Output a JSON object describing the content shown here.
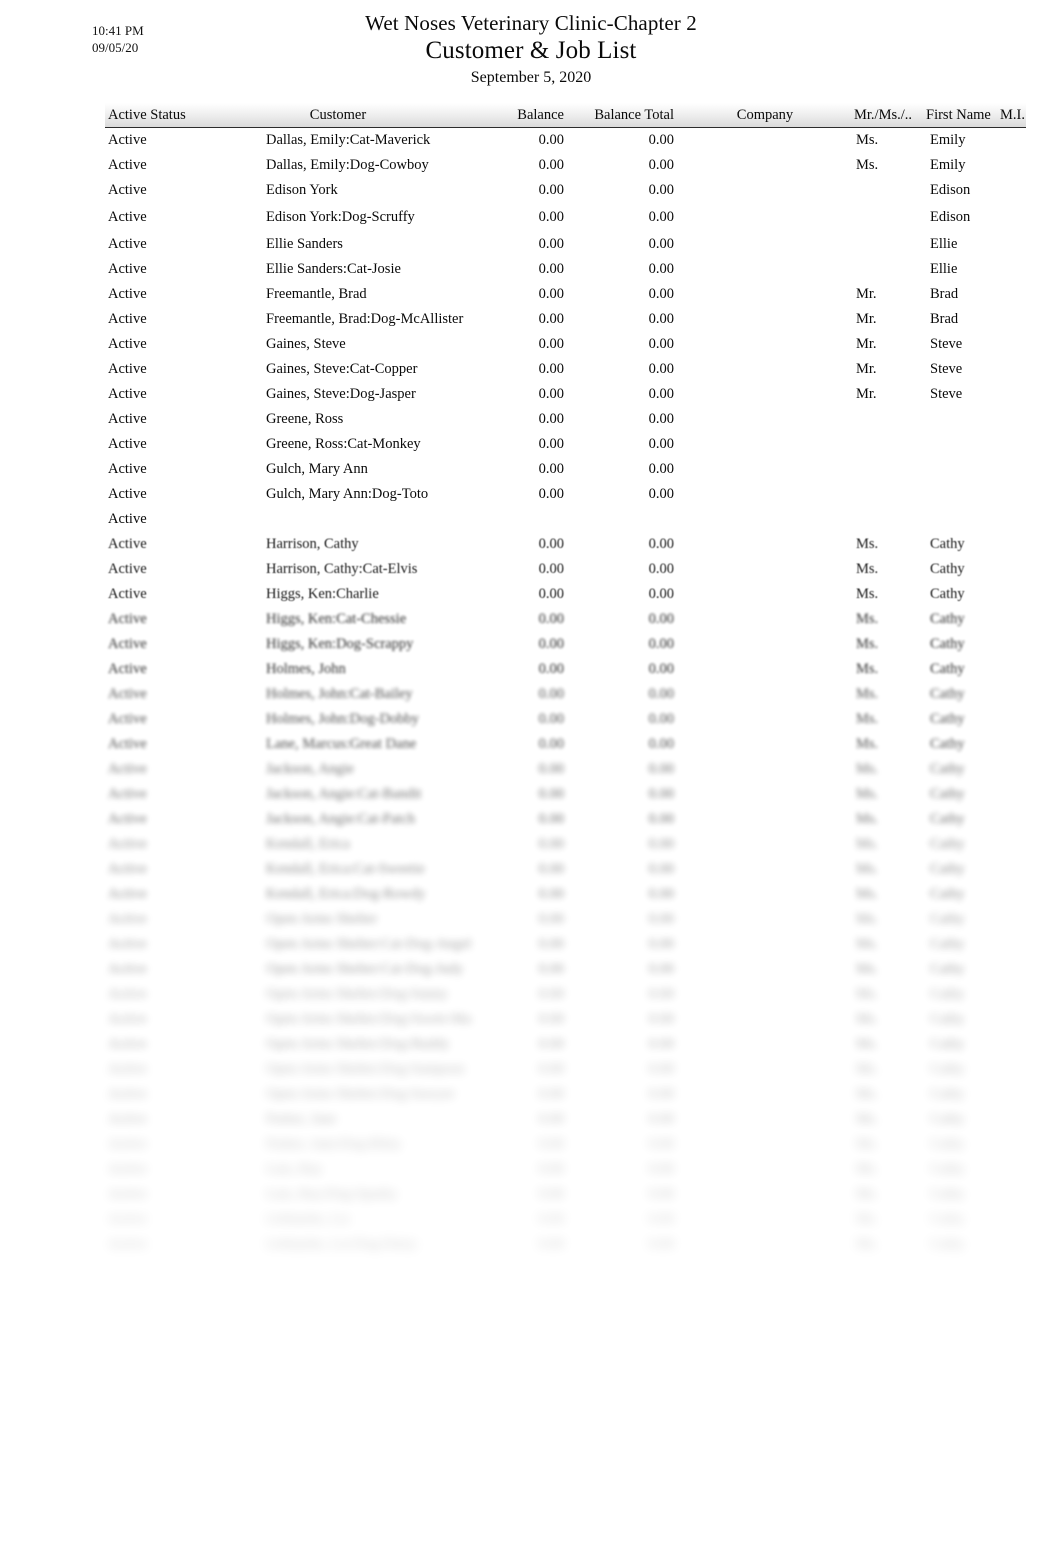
{
  "page": {
    "print_time": "10:41 PM",
    "print_date": "09/05/20"
  },
  "header": {
    "company_title": "Wet Noses Veterinary Clinic-Chapter 2",
    "report_title": "Customer & Job List",
    "report_date": "September 5, 2020"
  },
  "table": {
    "columns": [
      {
        "key": "status",
        "label": "Active Status"
      },
      {
        "key": "customer",
        "label": "Customer"
      },
      {
        "key": "balance",
        "label": "Balance"
      },
      {
        "key": "baltotal",
        "label": "Balance Total"
      },
      {
        "key": "company",
        "label": "Company"
      },
      {
        "key": "title",
        "label": "Mr./Ms./..."
      },
      {
        "key": "first",
        "label": "First Name"
      },
      {
        "key": "mi",
        "label": "M.I."
      }
    ],
    "rows": [
      {
        "status": "Active",
        "customer": "Dallas, Emily:Cat-Maverick",
        "balance": "0.00",
        "baltotal": "0.00",
        "company": "",
        "title": "Ms.",
        "first": "Emily",
        "mi": ""
      },
      {
        "status": "Active",
        "customer": "Dallas, Emily:Dog-Cowboy",
        "balance": "0.00",
        "baltotal": "0.00",
        "company": "",
        "title": "Ms.",
        "first": "Emily",
        "mi": ""
      },
      {
        "status": "Active",
        "customer": "Edison York",
        "balance": "0.00",
        "baltotal": "0.00",
        "company": "",
        "title": "",
        "first": "Edison",
        "mi": ""
      },
      {
        "status": "Active",
        "customer": "Edison York:Dog-Scruffy",
        "balance": "0.00",
        "baltotal": "0.00",
        "company": "",
        "title": "",
        "first": "Edison",
        "mi": ""
      },
      {
        "status": "Active",
        "customer": "Ellie Sanders",
        "balance": "0.00",
        "baltotal": "0.00",
        "company": "",
        "title": "",
        "first": "Ellie",
        "mi": ""
      },
      {
        "status": "Active",
        "customer": "Ellie Sanders:Cat-Josie",
        "balance": "0.00",
        "baltotal": "0.00",
        "company": "",
        "title": "",
        "first": "Ellie",
        "mi": ""
      },
      {
        "status": "Active",
        "customer": "Freemantle, Brad",
        "balance": "0.00",
        "baltotal": "0.00",
        "company": "",
        "title": "Mr.",
        "first": "Brad",
        "mi": ""
      },
      {
        "status": "Active",
        "customer": "Freemantle, Brad:Dog-McAllister",
        "balance": "0.00",
        "baltotal": "0.00",
        "company": "",
        "title": "Mr.",
        "first": "Brad",
        "mi": ""
      },
      {
        "status": "Active",
        "customer": "Gaines, Steve",
        "balance": "0.00",
        "baltotal": "0.00",
        "company": "",
        "title": "Mr.",
        "first": "Steve",
        "mi": ""
      },
      {
        "status": "Active",
        "customer": "Gaines, Steve:Cat-Copper",
        "balance": "0.00",
        "baltotal": "0.00",
        "company": "",
        "title": "Mr.",
        "first": "Steve",
        "mi": ""
      },
      {
        "status": "Active",
        "customer": "Gaines, Steve:Dog-Jasper",
        "balance": "0.00",
        "baltotal": "0.00",
        "company": "",
        "title": "Mr.",
        "first": "Steve",
        "mi": ""
      },
      {
        "status": "Active",
        "customer": "Greene, Ross",
        "balance": "0.00",
        "baltotal": "0.00",
        "company": "",
        "title": "",
        "first": "",
        "mi": ""
      },
      {
        "status": "Active",
        "customer": "Greene, Ross:Cat-Monkey",
        "balance": "0.00",
        "baltotal": "0.00",
        "company": "",
        "title": "",
        "first": "",
        "mi": ""
      },
      {
        "status": "Active",
        "customer": "Gulch, Mary Ann",
        "balance": "0.00",
        "baltotal": "0.00",
        "company": "",
        "title": "",
        "first": "",
        "mi": ""
      },
      {
        "status": "Active",
        "customer": "Gulch, Mary Ann:Dog-Toto",
        "balance": "0.00",
        "baltotal": "0.00",
        "company": "",
        "title": "",
        "first": "",
        "mi": ""
      },
      {
        "status": "Active",
        "customer": "",
        "balance": "",
        "baltotal": "",
        "company": "",
        "title": "",
        "first": "",
        "mi": ""
      },
      {
        "status": "",
        "customer": "",
        "balance": "",
        "baltotal": "",
        "company": "",
        "title": "",
        "first": "",
        "mi": ""
      },
      {
        "status": "",
        "customer": "",
        "balance": "",
        "baltotal": "",
        "company": "",
        "title": "",
        "first": "",
        "mi": ""
      },
      {
        "status": "",
        "customer": "",
        "balance": "",
        "baltotal": "",
        "company": "",
        "title": "",
        "first": "",
        "mi": ""
      },
      {
        "status": "",
        "customer": "",
        "balance": "",
        "baltotal": "",
        "company": "",
        "title": "",
        "first": "",
        "mi": ""
      },
      {
        "status": "",
        "customer": "",
        "balance": "",
        "baltotal": "",
        "company": "",
        "title": "",
        "first": "",
        "mi": ""
      },
      {
        "status": "",
        "customer": "",
        "balance": "",
        "baltotal": "",
        "company": "",
        "title": "",
        "first": "",
        "mi": ""
      },
      {
        "status": "",
        "customer": "",
        "balance": "",
        "baltotal": "",
        "company": "",
        "title": "",
        "first": "",
        "mi": ""
      },
      {
        "status": "",
        "customer": "",
        "balance": "",
        "baltotal": "",
        "company": "",
        "title": "",
        "first": "",
        "mi": ""
      },
      {
        "status": "",
        "customer": "",
        "balance": "",
        "baltotal": "",
        "company": "",
        "title": "",
        "first": "",
        "mi": ""
      },
      {
        "status": "",
        "customer": "",
        "balance": "",
        "baltotal": "",
        "company": "",
        "title": "",
        "first": "",
        "mi": ""
      },
      {
        "status": "",
        "customer": "",
        "balance": "",
        "baltotal": "",
        "company": "",
        "title": "",
        "first": "",
        "mi": ""
      },
      {
        "status": "",
        "customer": "",
        "balance": "",
        "baltotal": "",
        "company": "",
        "title": "",
        "first": "",
        "mi": ""
      },
      {
        "status": "",
        "customer": "",
        "balance": "",
        "baltotal": "",
        "company": "",
        "title": "",
        "first": "",
        "mi": ""
      },
      {
        "status": "",
        "customer": "",
        "balance": "",
        "baltotal": "",
        "company": "",
        "title": "",
        "first": "",
        "mi": ""
      },
      {
        "status": "",
        "customer": "",
        "balance": "",
        "baltotal": "",
        "company": "",
        "title": "",
        "first": "",
        "mi": ""
      },
      {
        "status": "",
        "customer": "",
        "balance": "",
        "baltotal": "",
        "company": "",
        "title": "",
        "first": "",
        "mi": ""
      },
      {
        "status": "",
        "customer": "",
        "balance": "",
        "baltotal": "",
        "company": "",
        "title": "",
        "first": "",
        "mi": ""
      },
      {
        "status": "",
        "customer": "",
        "balance": "",
        "baltotal": "",
        "company": "",
        "title": "",
        "first": "",
        "mi": ""
      },
      {
        "status": "",
        "customer": "",
        "balance": "",
        "baltotal": "",
        "company": "",
        "title": "",
        "first": "",
        "mi": ""
      },
      {
        "status": "",
        "customer": "",
        "balance": "",
        "baltotal": "",
        "company": "",
        "title": "",
        "first": "",
        "mi": ""
      },
      {
        "status": "",
        "customer": "",
        "balance": "",
        "baltotal": "",
        "company": "",
        "title": "",
        "first": "",
        "mi": ""
      },
      {
        "status": "",
        "customer": "",
        "balance": "",
        "baltotal": "",
        "company": "",
        "title": "",
        "first": "",
        "mi": ""
      },
      {
        "status": "",
        "customer": "",
        "balance": "",
        "baltotal": "",
        "company": "",
        "title": "",
        "first": "",
        "mi": ""
      },
      {
        "status": "",
        "customer": "",
        "balance": "",
        "baltotal": "",
        "company": "",
        "title": "",
        "first": "",
        "mi": ""
      },
      {
        "status": "",
        "customer": "",
        "balance": "",
        "baltotal": "",
        "company": "",
        "title": "",
        "first": "",
        "mi": ""
      },
      {
        "status": "",
        "customer": "",
        "balance": "",
        "baltotal": "",
        "company": "",
        "title": "",
        "first": "",
        "mi": ""
      },
      {
        "status": "",
        "customer": "",
        "balance": "",
        "baltotal": "",
        "company": "",
        "title": "",
        "first": "",
        "mi": ""
      },
      {
        "status": "",
        "customer": "",
        "balance": "",
        "baltotal": "",
        "company": "",
        "title": "",
        "first": "",
        "mi": ""
      },
      {
        "status": "",
        "customer": "",
        "balance": "",
        "baltotal": "",
        "company": "",
        "title": "",
        "first": "",
        "mi": ""
      }
    ]
  }
}
